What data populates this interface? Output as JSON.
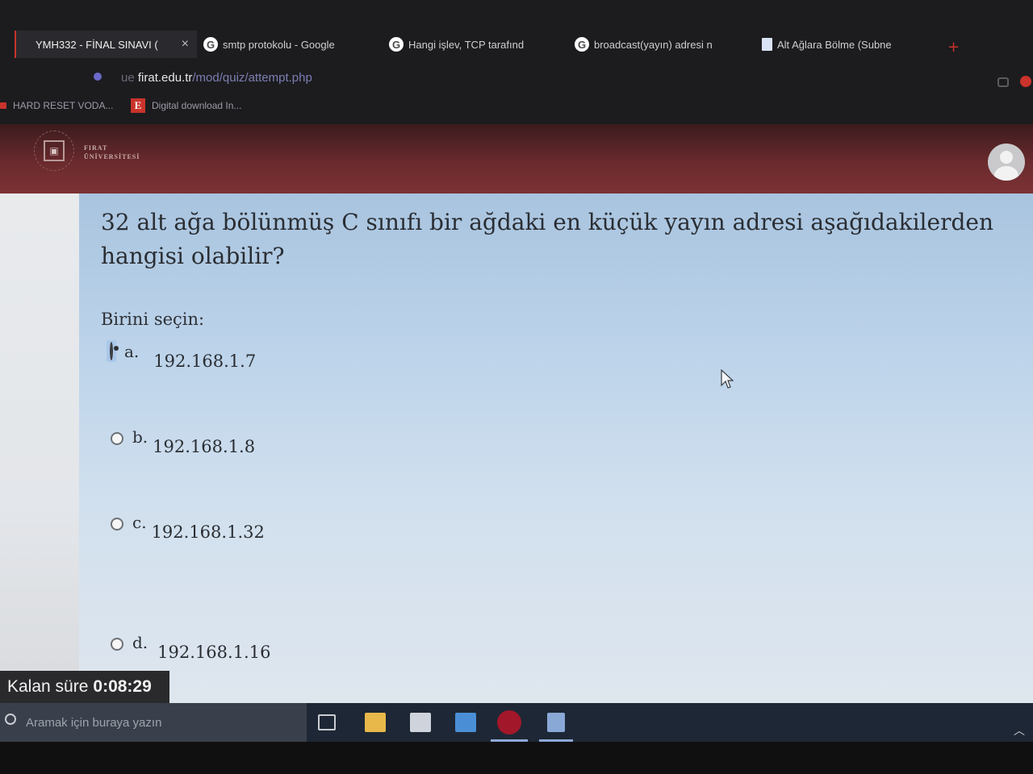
{
  "browser": {
    "tabs": [
      {
        "label": "YMH332 - FİNAL SINAVI (",
        "icon": "moodle-icon",
        "active": true
      },
      {
        "label": "smtp protokolu - Google",
        "icon": "google-icon"
      },
      {
        "label": "Hangi işlev, TCP tarafınd",
        "icon": "google-icon"
      },
      {
        "label": "broadcast(yayın) adresi n",
        "icon": "google-icon"
      },
      {
        "label": "Alt Ağlara Bölme (Subne",
        "icon": "document-icon"
      }
    ],
    "new_tab_symbol": "+",
    "close_symbol": "×",
    "url": {
      "scheme": "ue ",
      "host": "firat.edu.tr",
      "path": "/mod/quiz/attempt.php"
    },
    "bookmarks": [
      {
        "label": "HARD RESET VODA..."
      },
      {
        "label": "Digital download In...",
        "badge": "E"
      }
    ]
  },
  "site": {
    "logo_line1": "FIRAT",
    "logo_line2": "ÜNİVERSİTESİ"
  },
  "quiz": {
    "question": "32 alt ağa bölünmüş C sınıfı bir ağdaki en küçük yayın adresi aşağıdakilerden hangisi olabilir?",
    "prompt": "Birini seçin:",
    "options": [
      {
        "letter": "a.",
        "value": "192.168.1.7",
        "selected": true
      },
      {
        "letter": "b.",
        "value": "192.168.1.8",
        "selected": false
      },
      {
        "letter": "c.",
        "value": "192.168.1.32",
        "selected": false
      },
      {
        "letter": "d.",
        "value": "192.168.1.16",
        "selected": false
      }
    ],
    "timer_label": "Kalan süre",
    "timer_value": "0:08:29"
  },
  "taskbar": {
    "search_placeholder": "Aramak için buraya yazın",
    "apps": [
      "task-view-icon",
      "file-explorer-icon",
      "store-icon",
      "mail-icon",
      "opera-icon",
      "calculator-icon"
    ]
  },
  "colors": {
    "accent_red": "#c9332b",
    "header_maroon": "#6a2a2d",
    "selected_radio_bg": "#a9c8ea"
  }
}
